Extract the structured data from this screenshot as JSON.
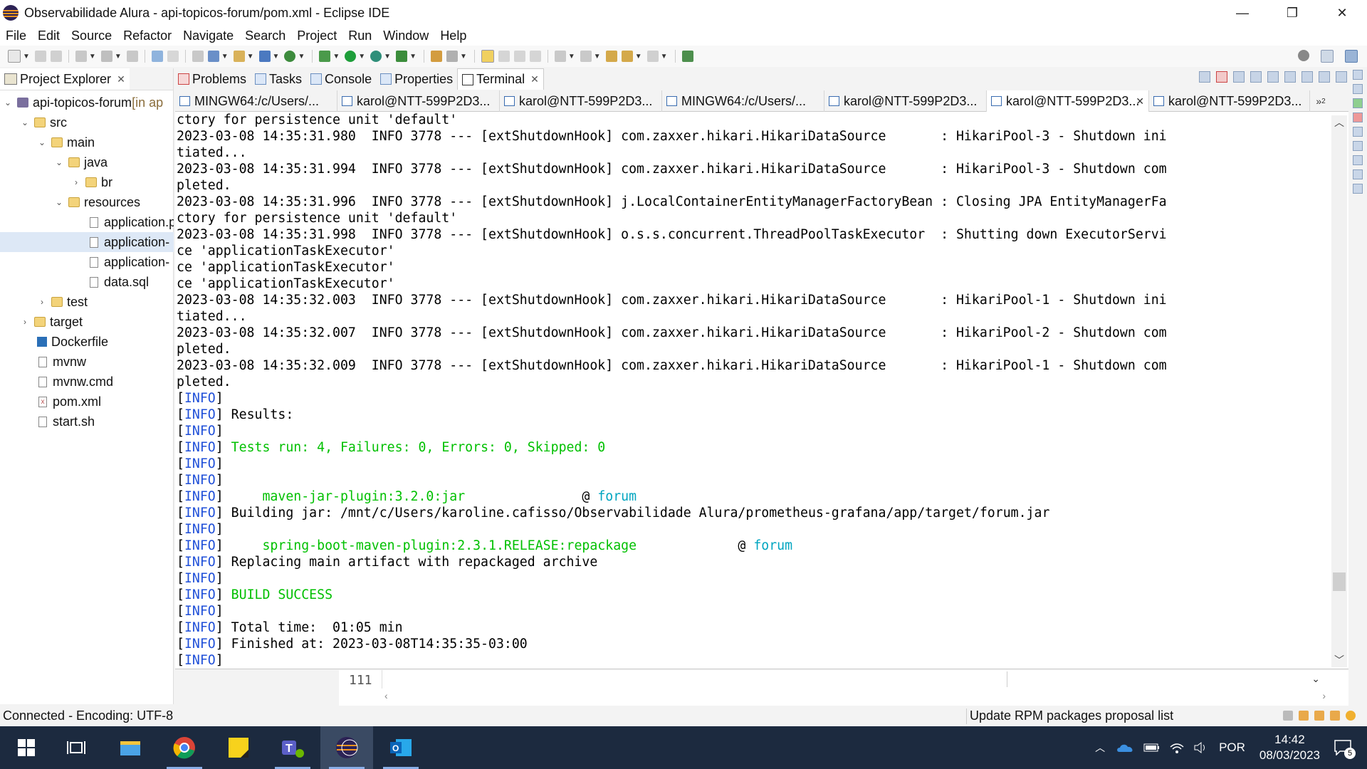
{
  "window": {
    "title": "Observabilidade Alura - api-topicos-forum/pom.xml - Eclipse IDE",
    "controls": {
      "minimize": "—",
      "maximize": "❐",
      "close": "✕"
    }
  },
  "menu": [
    "File",
    "Edit",
    "Source",
    "Refactor",
    "Navigate",
    "Search",
    "Project",
    "Run",
    "Window",
    "Help"
  ],
  "project_explorer": {
    "tab_label": "Project Explorer",
    "close": "✕",
    "tree": [
      {
        "label": "api-topicos-forum",
        "suffix": " [in ap",
        "twisty": "⌄",
        "icon": "project"
      },
      {
        "label": "src",
        "twisty": "⌄",
        "icon": "folder"
      },
      {
        "label": "main",
        "twisty": "⌄",
        "icon": "folder"
      },
      {
        "label": "java",
        "twisty": "⌄",
        "icon": "folder"
      },
      {
        "label": "br",
        "twisty": "›",
        "icon": "folder"
      },
      {
        "label": "resources",
        "twisty": "⌄",
        "icon": "folder"
      },
      {
        "label": "application.p",
        "icon": "file"
      },
      {
        "label": "application-",
        "icon": "file",
        "selected": true
      },
      {
        "label": "application-",
        "icon": "file"
      },
      {
        "label": "data.sql",
        "icon": "file"
      },
      {
        "label": "test",
        "twisty": "›",
        "icon": "folder"
      },
      {
        "label": "target",
        "twisty": "›",
        "icon": "folder"
      },
      {
        "label": "Dockerfile",
        "icon": "docker"
      },
      {
        "label": "mvnw",
        "icon": "file"
      },
      {
        "label": "mvnw.cmd",
        "icon": "file"
      },
      {
        "label": "pom.xml",
        "icon": "xml"
      },
      {
        "label": "start.sh",
        "icon": "file"
      }
    ]
  },
  "views": {
    "tabs": [
      "Problems",
      "Tasks",
      "Console",
      "Properties",
      "Terminal"
    ],
    "active": "Terminal",
    "close": "✕"
  },
  "terminal_tabs": {
    "tabs": [
      {
        "label": "MINGW64:/c/Users/..."
      },
      {
        "label": "karol@NTT-599P2D3..."
      },
      {
        "label": "karol@NTT-599P2D3..."
      },
      {
        "label": "MINGW64:/c/Users/..."
      },
      {
        "label": "karol@NTT-599P2D3..."
      },
      {
        "label": "karol@NTT-599P2D3...",
        "active": true,
        "close": "✕"
      },
      {
        "label": "karol@NTT-599P2D3..."
      }
    ],
    "more": "»",
    "more_count": "2"
  },
  "terminal": {
    "lines": [
      [
        {
          "t": "ctory for persistence unit 'default'"
        }
      ],
      [
        {
          "t": "2023-03-08 14:35:31.980  INFO 3778 --- [extShutdownHook] com.zaxxer.hikari.HikariDataSource       : HikariPool-3 - Shutdown ini"
        }
      ],
      [
        {
          "t": "tiated..."
        }
      ],
      [
        {
          "t": "2023-03-08 14:35:31.994  INFO 3778 --- [extShutdownHook] com.zaxxer.hikari.HikariDataSource       : HikariPool-3 - Shutdown com"
        }
      ],
      [
        {
          "t": "pleted."
        }
      ],
      [
        {
          "t": "2023-03-08 14:35:31.996  INFO 3778 --- [extShutdownHook] j.LocalContainerEntityManagerFactoryBean : Closing JPA EntityManagerFa"
        }
      ],
      [
        {
          "t": "ctory for persistence unit 'default'"
        }
      ],
      [
        {
          "t": "2023-03-08 14:35:31.998  INFO 3778 --- [extShutdownHook] o.s.s.concurrent.ThreadPoolTaskExecutor  : Shutting down ExecutorServi"
        }
      ],
      [
        {
          "t": "ce 'applicationTaskExecutor'"
        }
      ],
      [
        {
          "t": "ce 'applicationTaskExecutor'"
        }
      ],
      [
        {
          "t": "ce 'applicationTaskExecutor'"
        }
      ],
      [
        {
          "t": "2023-03-08 14:35:32.003  INFO 3778 --- [extShutdownHook] com.zaxxer.hikari.HikariDataSource       : HikariPool-1 - Shutdown ini"
        }
      ],
      [
        {
          "t": "tiated..."
        }
      ],
      [
        {
          "t": "2023-03-08 14:35:32.007  INFO 3778 --- [extShutdownHook] com.zaxxer.hikari.HikariDataSource       : HikariPool-2 - Shutdown com"
        }
      ],
      [
        {
          "t": "pleted."
        }
      ],
      [
        {
          "t": "2023-03-08 14:35:32.009  INFO 3778 --- [extShutdownHook] com.zaxxer.hikari.HikariDataSource       : HikariPool-1 - Shutdown com"
        }
      ],
      [
        {
          "t": "pleted."
        }
      ],
      [
        {
          "t": "["
        },
        {
          "t": "INFO",
          "c": "blue"
        },
        {
          "t": "]"
        }
      ],
      [
        {
          "t": "["
        },
        {
          "t": "INFO",
          "c": "blue"
        },
        {
          "t": "] Results:"
        }
      ],
      [
        {
          "t": "["
        },
        {
          "t": "INFO",
          "c": "blue"
        },
        {
          "t": "]"
        }
      ],
      [
        {
          "t": "["
        },
        {
          "t": "INFO",
          "c": "blue"
        },
        {
          "t": "] "
        },
        {
          "t": "Tests run: 4, Failures: 0, Errors: 0, Skipped: 0",
          "c": "green"
        }
      ],
      [
        {
          "t": "["
        },
        {
          "t": "INFO",
          "c": "blue"
        },
        {
          "t": "]"
        }
      ],
      [
        {
          "t": "["
        },
        {
          "t": "INFO",
          "c": "blue"
        },
        {
          "t": "]"
        }
      ],
      [
        {
          "t": "["
        },
        {
          "t": "INFO",
          "c": "blue"
        },
        {
          "t": "]     "
        },
        {
          "t": "maven-jar-plugin:3.2.0:jar",
          "c": "green"
        },
        {
          "t": "               @ "
        },
        {
          "t": "forum",
          "c": "cyan"
        }
      ],
      [
        {
          "t": "["
        },
        {
          "t": "INFO",
          "c": "blue"
        },
        {
          "t": "] Building jar: /mnt/c/Users/karoline.cafisso/Observabilidade Alura/prometheus-grafana/app/target/forum.jar"
        }
      ],
      [
        {
          "t": "["
        },
        {
          "t": "INFO",
          "c": "blue"
        },
        {
          "t": "]"
        }
      ],
      [
        {
          "t": "["
        },
        {
          "t": "INFO",
          "c": "blue"
        },
        {
          "t": "]     "
        },
        {
          "t": "spring-boot-maven-plugin:2.3.1.RELEASE:repackage",
          "c": "green"
        },
        {
          "t": "             @ "
        },
        {
          "t": "forum",
          "c": "cyan"
        }
      ],
      [
        {
          "t": "["
        },
        {
          "t": "INFO",
          "c": "blue"
        },
        {
          "t": "] Replacing main artifact with repackaged archive"
        }
      ],
      [
        {
          "t": "["
        },
        {
          "t": "INFO",
          "c": "blue"
        },
        {
          "t": "]"
        }
      ],
      [
        {
          "t": "["
        },
        {
          "t": "INFO",
          "c": "blue"
        },
        {
          "t": "] "
        },
        {
          "t": "BUILD SUCCESS",
          "c": "green"
        }
      ],
      [
        {
          "t": "["
        },
        {
          "t": "INFO",
          "c": "blue"
        },
        {
          "t": "]"
        }
      ],
      [
        {
          "t": "["
        },
        {
          "t": "INFO",
          "c": "blue"
        },
        {
          "t": "] Total time:  01:05 min"
        }
      ],
      [
        {
          "t": "["
        },
        {
          "t": "INFO",
          "c": "blue"
        },
        {
          "t": "] Finished at: 2023-03-08T14:35:35-03:00"
        }
      ],
      [
        {
          "t": "["
        },
        {
          "t": "INFO",
          "c": "blue"
        },
        {
          "t": "]"
        }
      ]
    ]
  },
  "editor": {
    "line_number": "111"
  },
  "status": {
    "left": "Connected - Encoding: UTF-8",
    "right": "Update RPM packages proposal list"
  },
  "taskbar": {
    "apps": [
      "start-button",
      "task-view",
      "file-explorer",
      "chrome",
      "sticky-notes",
      "teams",
      "eclipse",
      "outlook"
    ],
    "tray": {
      "language": "POR",
      "time": "14:42",
      "date": "08/03/2023",
      "notifications": "5"
    }
  },
  "colors": {
    "info_blue": "#1f4fd8",
    "success_green": "#00c000",
    "project_cyan": "#00a5c0",
    "taskbar": "#1c2a3f"
  }
}
